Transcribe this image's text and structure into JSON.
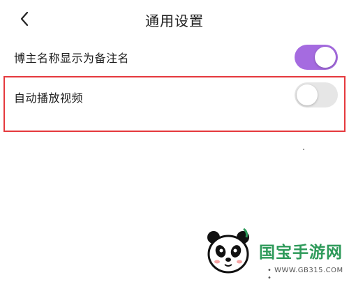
{
  "header": {
    "title": "通用设置",
    "back_icon": "chevron-left-icon"
  },
  "settings": [
    {
      "label": "博主名称显示为备注名",
      "enabled": true
    },
    {
      "label": "自动播放视频",
      "enabled": false
    }
  ],
  "colors": {
    "toggle_on": "#a56be0",
    "toggle_off": "#e6e6e6",
    "highlight": "#e5393d",
    "watermark_green": "#2e9a5a"
  },
  "watermark": {
    "title": "国宝手游网",
    "url": "• WWW.GB315.COM •"
  }
}
